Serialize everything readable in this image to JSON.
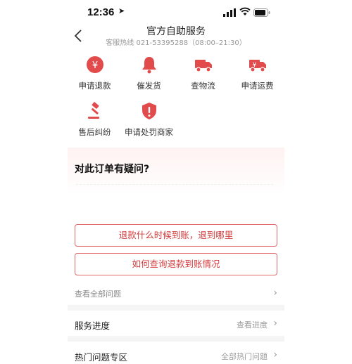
{
  "status": {
    "time": "12:36",
    "location_glyph": "➤"
  },
  "header": {
    "title": "官方自助服务",
    "subtitle": "客服热线 021-53395288（08:00–21:30）"
  },
  "services": [
    {
      "label": "申请退款",
      "icon": "yen-circle-icon"
    },
    {
      "label": "催发货",
      "icon": "bell-icon"
    },
    {
      "label": "查物流",
      "icon": "truck-icon"
    },
    {
      "label": "申请运费",
      "icon": "yen-truck-icon"
    },
    {
      "label": "售后纠纷",
      "icon": "gavel-icon"
    },
    {
      "label": "申请处罚商家",
      "icon": "shield-alert-icon"
    }
  ],
  "question": {
    "title": "对此订单有疑问?",
    "faq": [
      "退款什么时候到账，退到哪里",
      "如何查询退款到账情况"
    ],
    "view_all": "查看全部问题"
  },
  "service_progress": {
    "label": "服务进度",
    "action": "查看进度"
  },
  "hot_questions": {
    "label": "热门问题专区",
    "action": "全部热门问题"
  },
  "colors": {
    "accent": "#e24b4b",
    "border": "#e06a6a"
  }
}
